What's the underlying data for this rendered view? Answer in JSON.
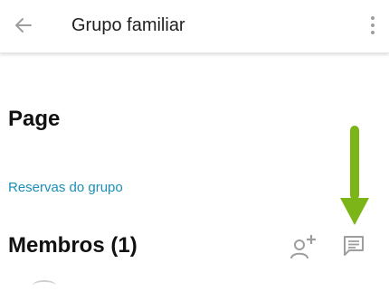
{
  "header": {
    "title": "Grupo familiar",
    "back_icon": "arrow-left-icon",
    "menu_icon": "more-vert-icon"
  },
  "main": {
    "page_heading": "Page",
    "group_link": "Reservas do grupo",
    "members_heading": "Membros (1)",
    "add_member_icon": "person-add-icon",
    "chat_icon": "message-icon"
  },
  "annotation": {
    "arrow_color": "#7cb518"
  },
  "colors": {
    "link": "#1a8fb8",
    "icon": "#9e9e9e",
    "text": "#212121"
  }
}
